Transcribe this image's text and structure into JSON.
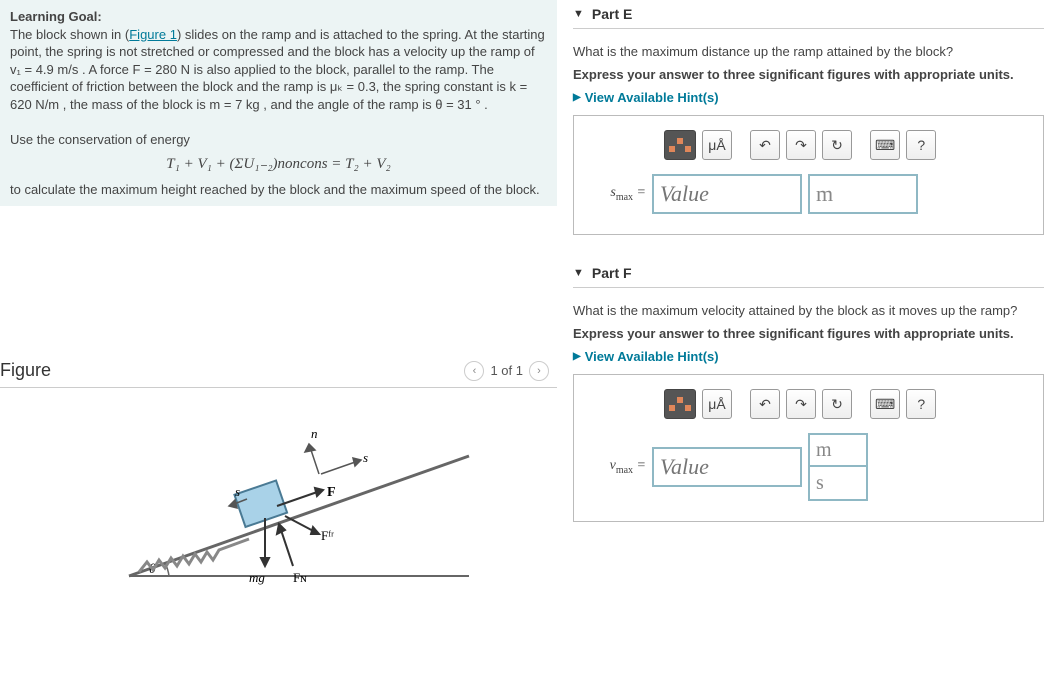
{
  "goal": {
    "heading": "Learning Goal:",
    "text1a": "The block shown in (",
    "figlink": "Figure 1",
    "text1b": ") slides on the ramp and is attached to the spring. At the starting point, the spring is not stretched or compressed and the block has a velocity up the ramp of v₁ = 4.9 m/s . A force F = 280 N is also applied to the block, parallel to the ramp. The coefficient of friction between the block and the ramp is μₖ = 0.3, the spring constant is k = 620 N/m , the mass of the block is m = 7 kg , and the angle of the ramp is θ = 31 ° .",
    "text2": "Use the conservation of energy",
    "equation": "T₁ + V₁ + (ΣU₁₋₂)noncons = T₂ + V₂",
    "text3": "to calculate the maximum height reached by the block and the maximum speed of the block."
  },
  "figure": {
    "title": "Figure",
    "pager": "1 of 1",
    "labels": {
      "n": "n",
      "s": "s",
      "F": "F",
      "Ffr": "Fᶠʳ",
      "mg": "mg",
      "FN": "Fɴ",
      "theta": "θ"
    }
  },
  "partE": {
    "title": "Part E",
    "question": "What is the maximum distance up the ramp attained by the block?",
    "instruction": "Express your answer to three significant figures with appropriate units.",
    "hints": "View Available Hint(s)",
    "var": "s",
    "varsub": "max",
    "placeholder": "Value",
    "unit": "m"
  },
  "partF": {
    "title": "Part F",
    "question": "What is the maximum velocity attained by the block as it moves up the ramp?",
    "instruction": "Express your answer to three significant figures with appropriate units.",
    "hints": "View Available Hint(s)",
    "var": "v",
    "varsub": "max",
    "placeholder": "Value",
    "unit_top": "m",
    "unit_bot": "s"
  },
  "toolbar": {
    "mu_a": "μÅ",
    "undo": "↶",
    "redo": "↷",
    "reset": "↻",
    "keyboard": "⌨",
    "help": "?"
  }
}
